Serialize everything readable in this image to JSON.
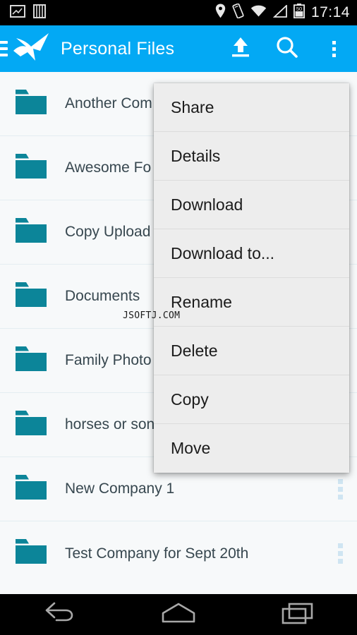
{
  "statusbar": {
    "time": "17:14",
    "left_icons": [
      "screenshot-icon",
      "book-icon"
    ],
    "right_icons": [
      "location-pin-icon",
      "vibrate-icon",
      "wifi-icon",
      "signal-icon",
      "battery-icon"
    ],
    "battery_level": "50",
    "background": "#000000"
  },
  "appbar": {
    "title": "Personal Files",
    "background": "#03A9F4",
    "text_color": "#FFFFFF",
    "nav_icon": "hamburger-menu-icon",
    "logo": "origami-crane-logo",
    "actions": [
      {
        "name": "upload",
        "icon": "upload-icon"
      },
      {
        "name": "search",
        "icon": "search-icon"
      },
      {
        "name": "overflow",
        "icon": "overflow-menu-icon"
      }
    ]
  },
  "list": {
    "folder_color": "#0C8599",
    "divider_color": "#E4EDF1",
    "background": "#F7F9FA",
    "text_color": "#37474F",
    "rows": [
      {
        "name": "Another Com",
        "icon": "folder-icon",
        "truncated": true
      },
      {
        "name": "Awesome Fo",
        "icon": "folder-icon",
        "truncated": true
      },
      {
        "name": "Copy Upload",
        "icon": "folder-icon",
        "truncated": true
      },
      {
        "name": "Documents",
        "icon": "folder-icon",
        "truncated": false
      },
      {
        "name": "Family Photo",
        "icon": "folder-icon",
        "truncated": true
      },
      {
        "name": "horses or son",
        "icon": "folder-icon",
        "truncated": true
      },
      {
        "name": "New Company 1",
        "icon": "folder-icon",
        "truncated": false
      },
      {
        "name": "Test Company for Sept 20th",
        "icon": "folder-icon",
        "truncated": false
      }
    ]
  },
  "context_menu": {
    "background": "#EDEDED",
    "items": [
      {
        "label": "Share"
      },
      {
        "label": "Details"
      },
      {
        "label": "Download"
      },
      {
        "label": "Download to..."
      },
      {
        "label": "Rename"
      },
      {
        "label": "Delete"
      },
      {
        "label": "Copy"
      },
      {
        "label": "Move"
      }
    ]
  },
  "watermark": {
    "text": "JSOFTJ.COM"
  },
  "navbar": {
    "background": "#000000",
    "buttons": [
      {
        "name": "back",
        "icon": "back-arrow-icon"
      },
      {
        "name": "home",
        "icon": "home-icon"
      },
      {
        "name": "recents",
        "icon": "recent-apps-icon"
      }
    ]
  }
}
